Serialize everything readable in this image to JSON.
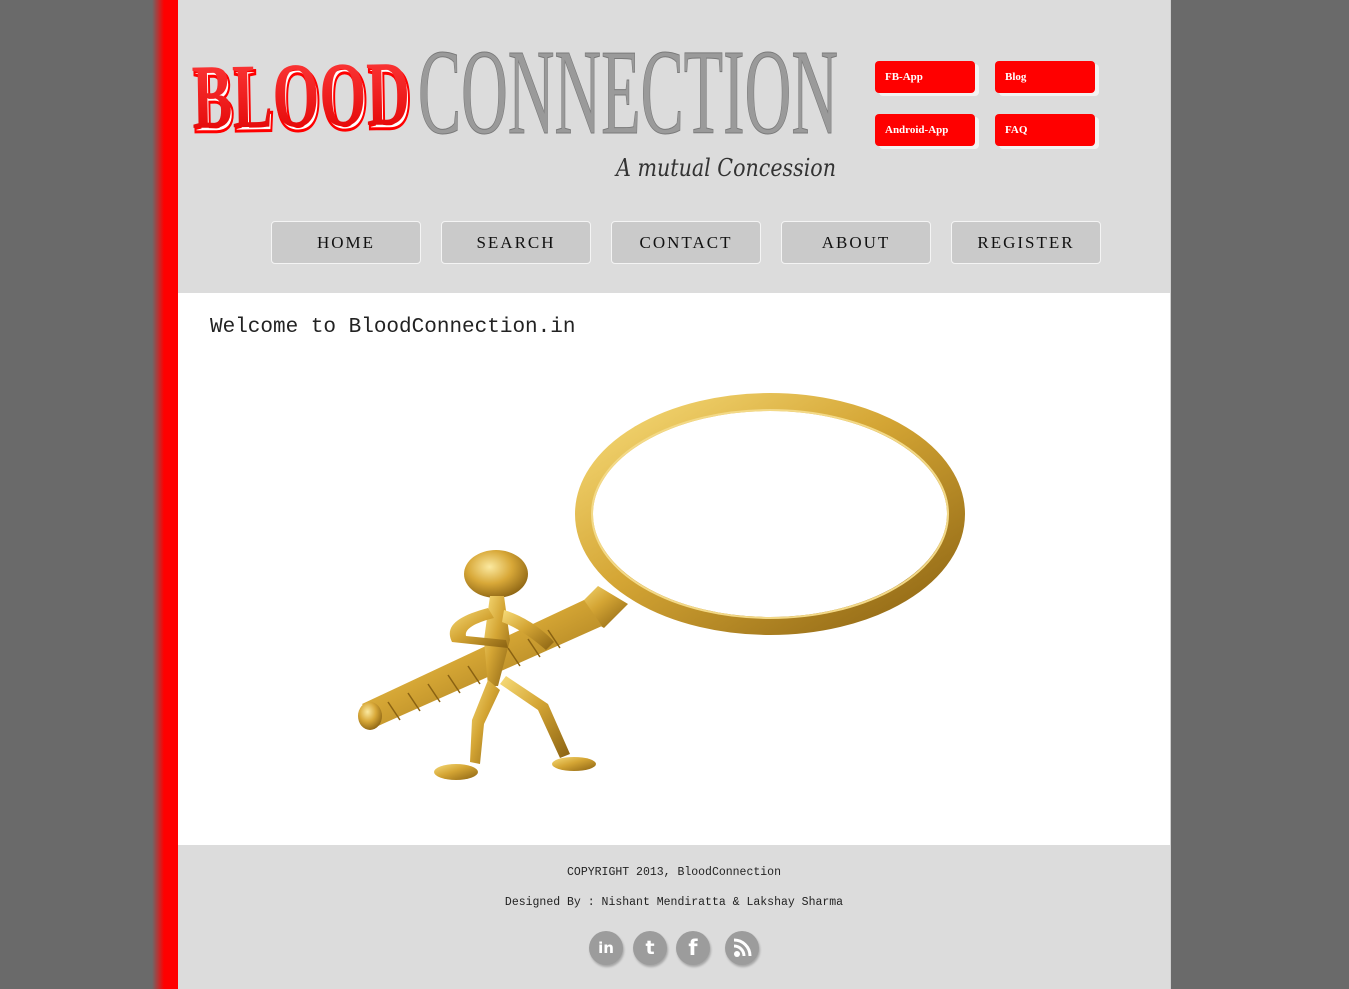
{
  "logo": {
    "word_blood": "BLOOD",
    "word_connection": "CONNECTION",
    "tagline": "A mutual Concession"
  },
  "top_buttons": {
    "fb_app": "FB-App",
    "blog": "Blog",
    "android_app": "Android-App",
    "faq": "FAQ"
  },
  "nav": {
    "home": "HOME",
    "search": "SEARCH",
    "contact": "CONTACT",
    "about": "ABOUT",
    "register": "REGISTER"
  },
  "main": {
    "welcome": "Welcome to BloodConnection.in"
  },
  "footer": {
    "copyright": "COPYRIGHT 2013, BloodConnection",
    "designed_by": "Designed By : Nishant Mendiratta & Lakshay Sharma",
    "social_icons": [
      "linkedin-icon",
      "tumblr-icon",
      "facebook-icon",
      "rss-icon"
    ]
  },
  "colors": {
    "accent_red": "#ff0000",
    "header_gray": "#dcdcdc",
    "nav_button_gray": "#cacaca",
    "backdrop": "#6a6a6a",
    "logo_gray": "#9a9a9a",
    "gold": "#d4a534"
  }
}
